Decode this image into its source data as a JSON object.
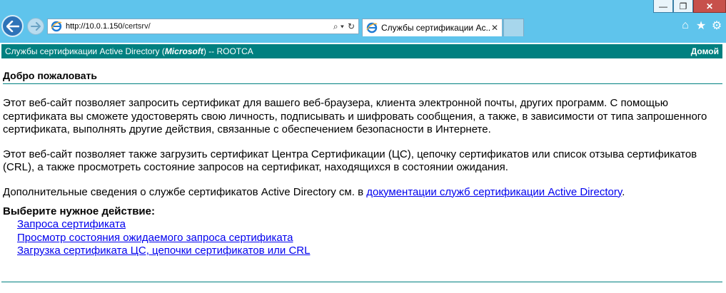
{
  "browser": {
    "url_host": "http://10.0.1.150",
    "url_path": "/certsrv/",
    "tab_title": "Службы сертификации Ac...",
    "window_controls": {
      "minimize": "—",
      "restore": "❐",
      "close": "✕"
    }
  },
  "banner": {
    "title_prefix": "Службы сертификации Active Directory (",
    "title_vendor": "Microsoft",
    "title_suffix": ")  --  ROOTCA",
    "home_link": "Домой"
  },
  "page": {
    "welcome": "Добро пожаловать",
    "para1": "Этот веб-сайт позволяет запросить сертификат для вашего веб-браузера, клиента электронной почты, других программ. С помощью сертификата вы сможете удостоверять свою личность, подписывать и шифровать сообщения, а также, в зависимости от типа запрошенного сертификата, выполнять другие действия, связанные с обеспечением безопасности в Интернете.",
    "para2": "Этот веб-сайт позволяет также загрузить сертификат Центра Сертификации (ЦС), цепочку сертификатов или список отзыва сертификатов (CRL), а также просмотреть состояние запросов на сертификат, находящихся в состоянии ожидания.",
    "para3_text": "Дополнительные сведения о службе сертификатов Active Directory см. в ",
    "para3_link": "документации служб сертификации Active Directory",
    "para3_end": ".",
    "choose_action": "Выберите нужное действие:",
    "actions": [
      "Запроса сертификата",
      "Просмотр состояния ожидаемого запроса сертификата",
      "Загрузка сертификата ЦС, цепочки сертификатов или CRL"
    ]
  },
  "colors": {
    "banner": "#008080",
    "chrome": "#5fc4ec",
    "link": "#0000ee"
  }
}
